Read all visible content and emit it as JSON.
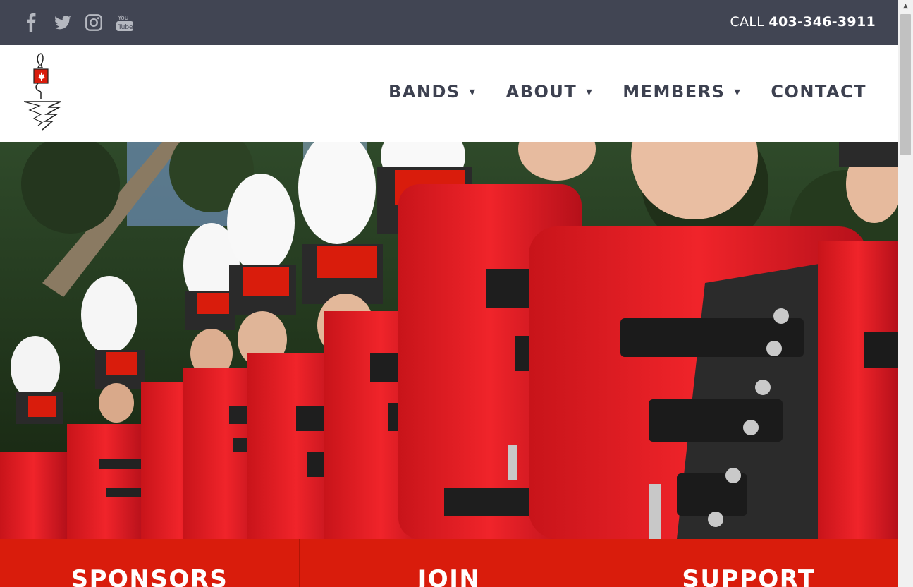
{
  "topbar": {
    "social": [
      {
        "icon": "facebook-icon"
      },
      {
        "icon": "twitter-icon"
      },
      {
        "icon": "instagram-icon"
      },
      {
        "icon": "youtube-icon"
      }
    ],
    "call_label": "CALL",
    "phone": "403-346-3911"
  },
  "nav": {
    "items": [
      {
        "label": "BANDS",
        "has_dropdown": true
      },
      {
        "label": "ABOUT",
        "has_dropdown": true
      },
      {
        "label": "MEMBERS",
        "has_dropdown": true
      },
      {
        "label": "CONTACT",
        "has_dropdown": false
      }
    ]
  },
  "cta": {
    "sponsors": "SPONSORS",
    "join": "JOIN",
    "support": "SUPPORT"
  },
  "colors": {
    "topbar": "#414553",
    "nav_text": "#3d4150",
    "accent_red": "#d91c0c"
  }
}
